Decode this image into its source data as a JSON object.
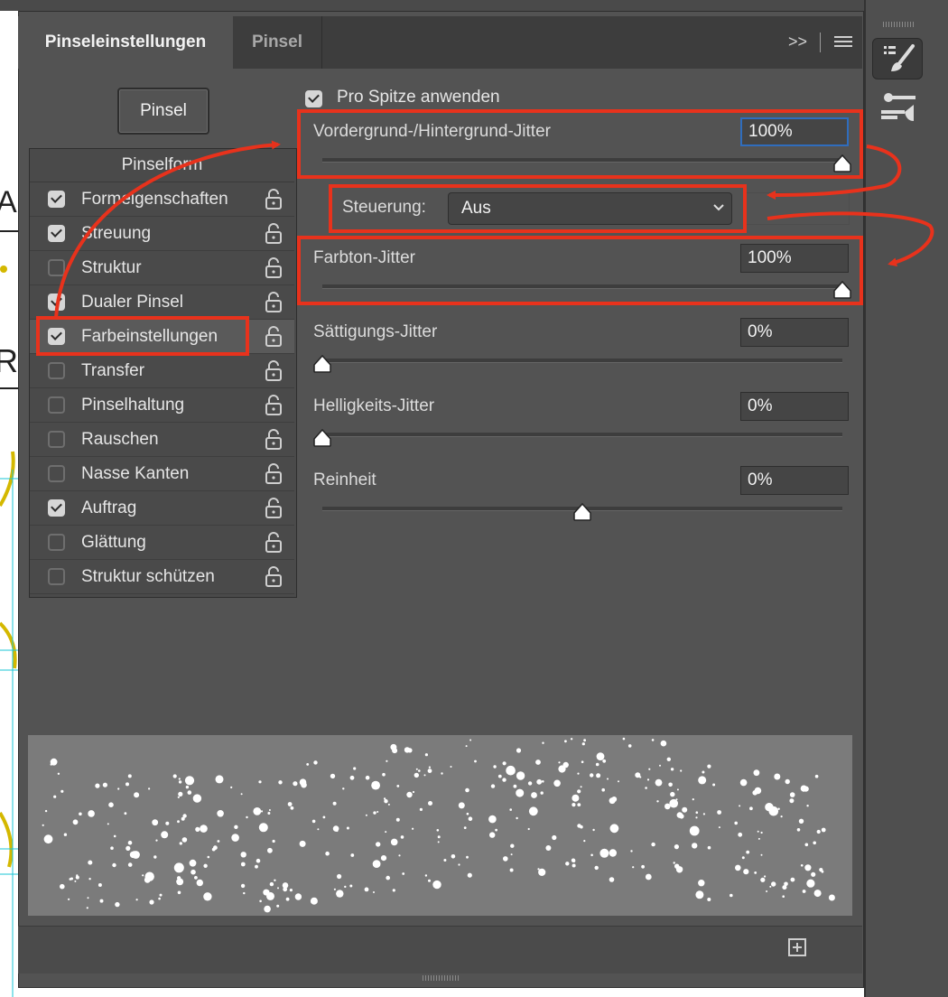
{
  "tabs": {
    "active": "Pinseleinstellungen",
    "inactive": "Pinsel",
    "collapse_glyph": ">>"
  },
  "pinsel_button": "Pinsel",
  "left_panel": {
    "header": "Pinselform",
    "items": [
      {
        "label": "Formeigenschaften",
        "checked": true
      },
      {
        "label": "Streuung",
        "checked": true
      },
      {
        "label": "Struktur",
        "checked": false
      },
      {
        "label": "Dualer Pinsel",
        "checked": true
      },
      {
        "label": "Farbeinstellungen",
        "checked": true,
        "selected": true
      },
      {
        "label": "Transfer",
        "checked": false
      },
      {
        "label": "Pinselhaltung",
        "checked": false
      },
      {
        "label": "Rauschen",
        "checked": false
      },
      {
        "label": "Nasse Kanten",
        "checked": false
      },
      {
        "label": "Auftrag",
        "checked": true
      },
      {
        "label": "Glättung",
        "checked": false
      },
      {
        "label": "Struktur schützen",
        "checked": false
      }
    ]
  },
  "pro_spitze": {
    "label": "Pro Spitze anwenden",
    "checked": true
  },
  "params": [
    {
      "label": "Vordergrund-/Hintergrund-Jitter",
      "value": "100%",
      "level": 1.0
    },
    {
      "label": "Farbton-Jitter",
      "value": "100%",
      "level": 1.0
    },
    {
      "label": "Sättigungs-Jitter",
      "value": "0%",
      "level": 0.0
    },
    {
      "label": "Helligkeits-Jitter",
      "value": "0%",
      "level": 0.0
    },
    {
      "label": "Reinheit",
      "value": "0%",
      "level": 0.5
    }
  ],
  "steuerung": {
    "label": "Steuerung:",
    "value": "Aus"
  },
  "colors": {
    "annotation": "#e8321c",
    "panel": "#535353",
    "focus": "#2f6dbd"
  },
  "icons": [
    "brush-panel-icon",
    "brush-settings-icon",
    "lock-icon",
    "chevron-down-icon",
    "menu-icon",
    "new-preset-icon"
  ]
}
